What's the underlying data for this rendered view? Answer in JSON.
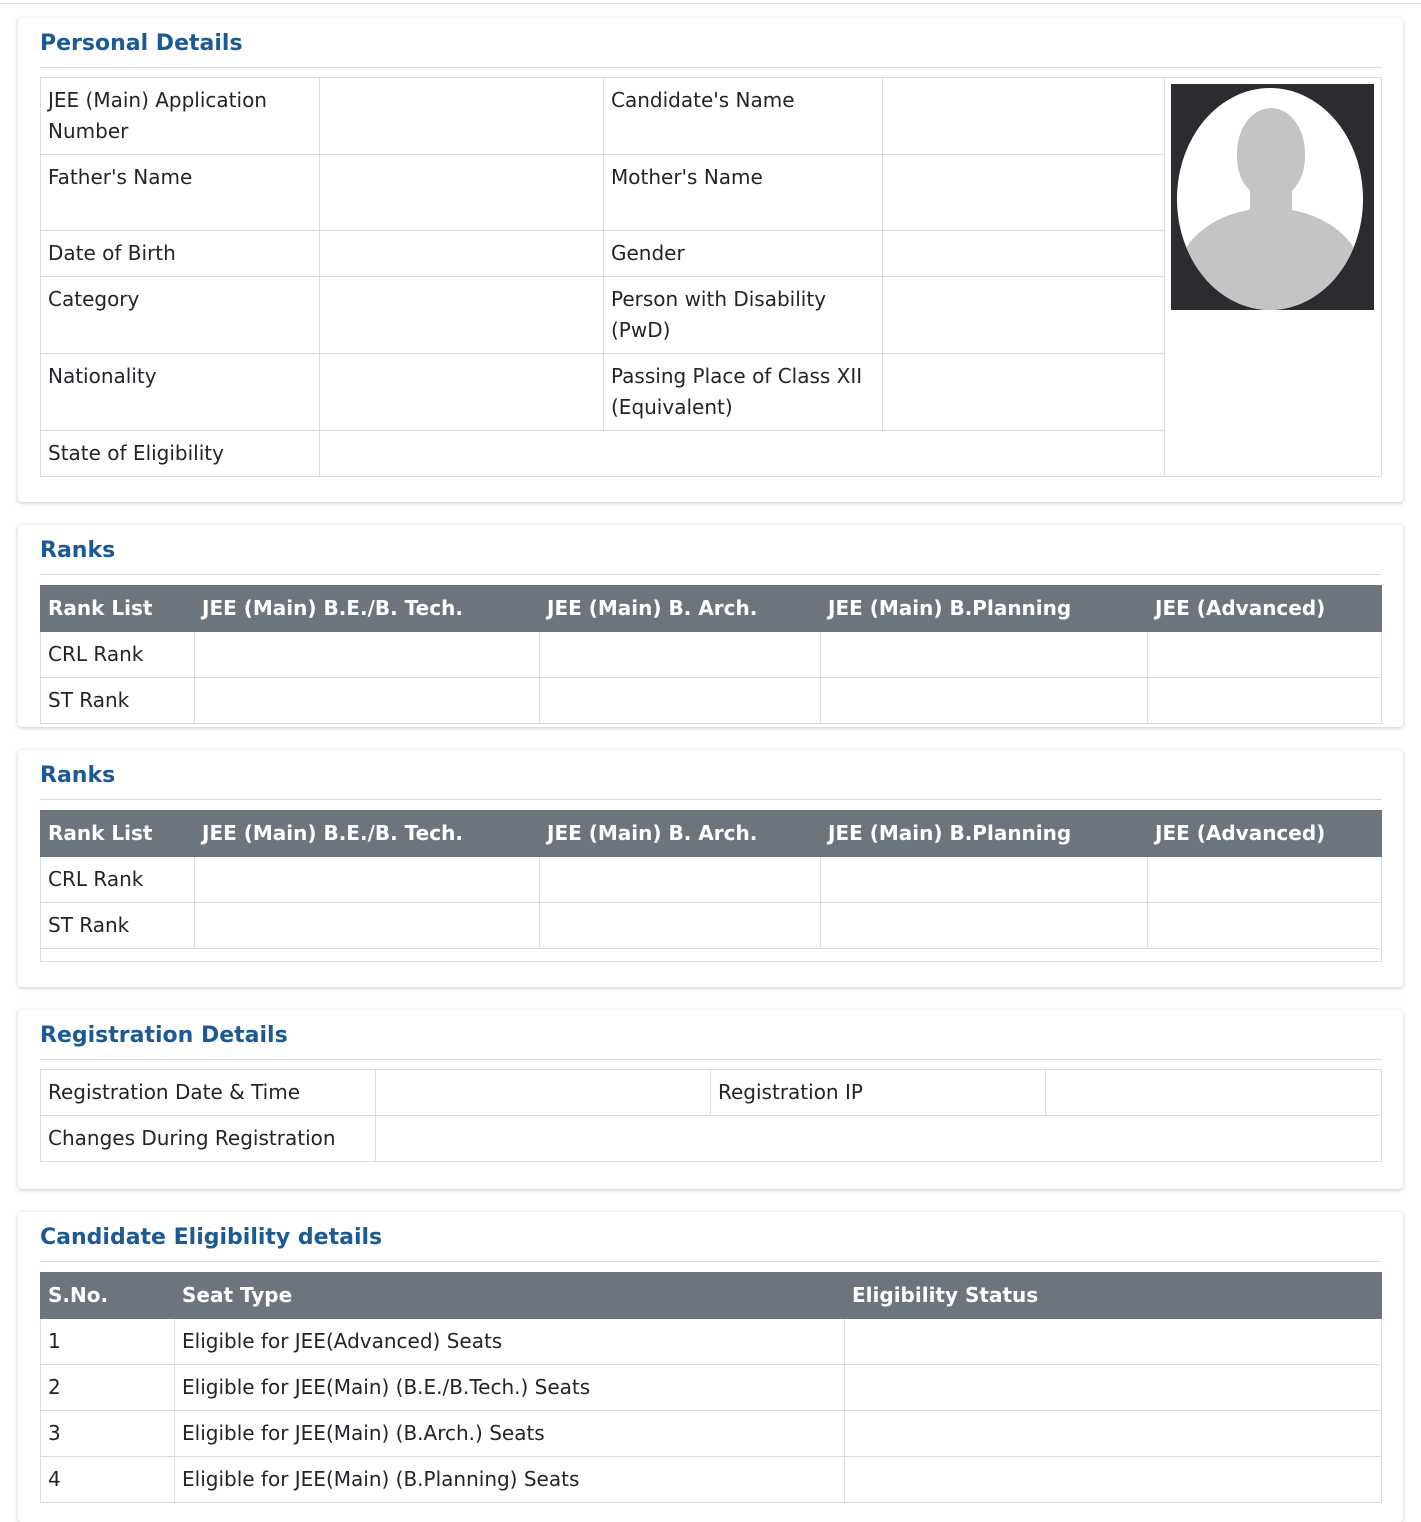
{
  "personal": {
    "title": "Personal Details",
    "app_no_label": "JEE (Main) Application Number",
    "cand_name_label": "Candidate's Name",
    "father_label": "Father's Name",
    "mother_label": "Mother's Name",
    "dob_label": "Date of Birth",
    "gender_label": "Gender",
    "category_label": "Category",
    "pwd_label": "Person with Disability (PwD)",
    "nationality_label": "Nationality",
    "passing_label": "Passing Place of Class XII (Equivalent)",
    "state_label": "State of Eligibility",
    "app_no_value": "",
    "cand_name_value": "",
    "father_value": "",
    "mother_value": "",
    "dob_value": "",
    "gender_value": "",
    "category_value": "",
    "pwd_value": "",
    "nationality_value": "",
    "passing_value": "",
    "state_value": ""
  },
  "ranks_headers": [
    "Rank List",
    "JEE (Main) B.E./B. Tech.",
    "JEE (Main) B. Arch.",
    "JEE (Main) B.Planning",
    "JEE (Advanced)"
  ],
  "ranks_rows": [
    "CRL Rank",
    "ST Rank"
  ],
  "ranks1": {
    "title": "Ranks"
  },
  "ranks2": {
    "title": "Ranks"
  },
  "registration": {
    "title": "Registration Details",
    "date_label": "Registration Date & Time",
    "ip_label": "Registration IP",
    "changes_label": "Changes During Registration",
    "date_value": "",
    "ip_value": "",
    "changes_value": ""
  },
  "eligibility": {
    "title": "Candidate Eligibility details",
    "headers": [
      "S.No.",
      "Seat Type",
      "Eligibility Status"
    ],
    "rows": [
      {
        "sno": "1",
        "seat": "Eligible for JEE(Advanced) Seats",
        "status": ""
      },
      {
        "sno": "2",
        "seat": "Eligible for JEE(Main) (B.E./B.Tech.) Seats",
        "status": ""
      },
      {
        "sno": "3",
        "seat": "Eligible for JEE(Main) (B.Arch.) Seats",
        "status": ""
      },
      {
        "sno": "4",
        "seat": "Eligible for JEE(Main) (B.Planning) Seats",
        "status": ""
      }
    ]
  }
}
